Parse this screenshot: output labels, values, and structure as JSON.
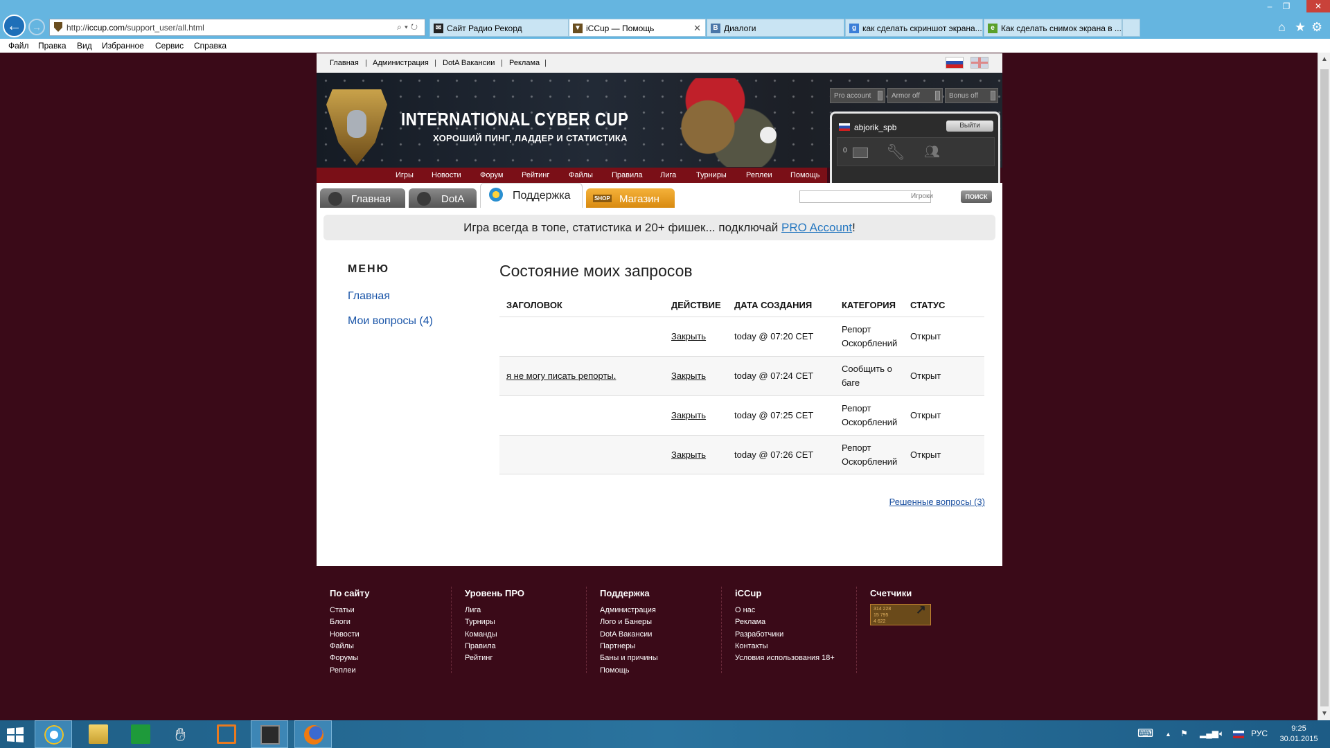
{
  "browser": {
    "url_prefix": "http://",
    "url_domain": "iccup.com",
    "url_path": "/support_user/all.html",
    "tabs": [
      {
        "label": "Сайт Радио Рекорд",
        "icon": "radio-record-icon"
      },
      {
        "label": "iCCup — Помощь",
        "icon": "iccup-icon"
      },
      {
        "label": "Диалоги",
        "icon": "vk-icon"
      },
      {
        "label": "как сделать скриншот экрана...",
        "icon": "google-icon"
      },
      {
        "label": "Как сделать снимок экрана в ...",
        "icon": "ie-tab-icon"
      }
    ],
    "menu": [
      "Файл",
      "Правка",
      "Вид",
      "Избранное",
      "Сервис",
      "Справка"
    ]
  },
  "site": {
    "top_links": [
      "Главная",
      "Администрация",
      "DotA Вакансии",
      "Реклама"
    ],
    "logo_title": "INTERNATIONAL CYBER CUP",
    "logo_subtitle": "ХОРОШИЙ ПИНГ, ЛАДДЕР И СТАТИСТИКА",
    "nav": [
      "Игры",
      "Новости",
      "Форум",
      "Рейтинг",
      "Файлы",
      "Правила",
      "Лига",
      "Турниры",
      "Реплеи",
      "Помощь"
    ],
    "account_toggles": [
      "Pro account",
      "Armor off",
      "Bonus off"
    ],
    "username": "abjorik_spb",
    "logout": "Выйти",
    "messages_count": "0",
    "section_tabs": [
      "Главная",
      "DotA",
      "Поддержка",
      "Магазин"
    ],
    "shop_badge": "SHOP",
    "search_scope": "Игроки",
    "search_button": "ПОИСК",
    "promo_text": "Игра всегда в топе, статистика и 20+ фишек... подключай ",
    "promo_link": "PRO Account",
    "promo_end": "!"
  },
  "sidebar": {
    "heading": "МЕНЮ",
    "items": [
      "Главная",
      "Мои вопросы (4)"
    ]
  },
  "main": {
    "title": "Состояние моих запросов",
    "columns": [
      "ЗАГОЛОВОК",
      "ДЕЙСТВИЕ",
      "ДАТА СОЗДАНИЯ",
      "КАТЕГОРИЯ",
      "СТАТУС"
    ],
    "rows": [
      {
        "title": "",
        "action": "Закрыть",
        "date": "today @ 07:20 CET",
        "cat1": "Репорт",
        "cat2": "Оскорблений",
        "status": "Открыт"
      },
      {
        "title": "я не могу писать репорты.",
        "action": "Закрыть",
        "date": "today @ 07:24 CET",
        "cat1": "Сообщить о",
        "cat2": "баге",
        "status": "Открыт"
      },
      {
        "title": "",
        "action": "Закрыть",
        "date": "today @ 07:25 CET",
        "cat1": "Репорт",
        "cat2": "Оскорблений",
        "status": "Открыт"
      },
      {
        "title": "",
        "action": "Закрыть",
        "date": "today @ 07:26 CET",
        "cat1": "Репорт",
        "cat2": "Оскорблений",
        "status": "Открыт"
      }
    ],
    "resolved_link": "Решенные вопросы (3)"
  },
  "footer": {
    "cols": [
      {
        "heading": "По сайту",
        "items": [
          "Статьи",
          "Блоги",
          "Новости",
          "Файлы",
          "Форумы",
          "Реплеи"
        ]
      },
      {
        "heading": "Уровень ПРО",
        "items": [
          "Лига",
          "Турниры",
          "Команды",
          "Правила",
          "Рейтинг"
        ]
      },
      {
        "heading": "Поддержка",
        "items": [
          "Администрация",
          "Лого и Банеры",
          "DotA Вакансии",
          "Партнеры",
          "Баны и причины",
          "Помощь"
        ]
      },
      {
        "heading": "iCCup",
        "items": [
          "О нас",
          "Реклама",
          "Разработчики",
          "Контакты",
          "Условия использования 18+"
        ]
      },
      {
        "heading": "Счетчики",
        "items": []
      }
    ],
    "counter_lines": [
      "314 228",
      "15 795",
      "4 622"
    ]
  },
  "taskbar": {
    "lang": "РУС",
    "time": "9:25",
    "date": "30.01.2015"
  }
}
